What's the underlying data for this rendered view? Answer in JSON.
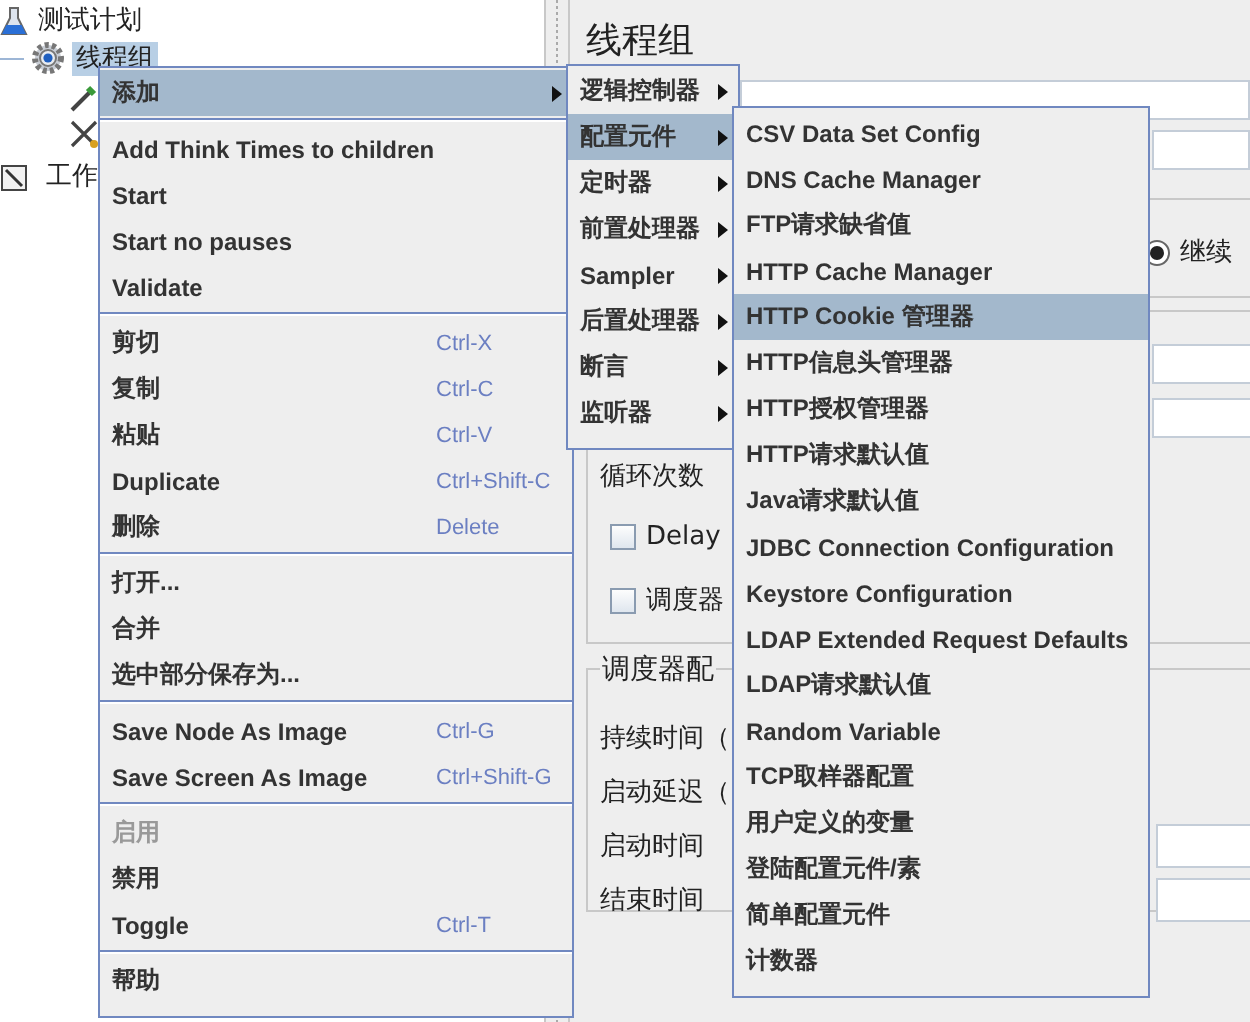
{
  "tree": {
    "items": [
      {
        "label": "测试计划",
        "selected": false,
        "children": [
          {
            "label": "线程组",
            "selected": true
          }
        ]
      },
      {
        "label": "工作",
        "selected": false
      }
    ]
  },
  "panel": {
    "title": "线程组",
    "continue_option": {
      "label": "继续",
      "selected": true
    },
    "loop_count": {
      "label": "循环次数"
    },
    "delay_option": {
      "label": "Delay",
      "checked": false
    },
    "scheduler_option": {
      "label": "调度器",
      "checked": false
    },
    "scheduler_group": {
      "title": "调度器配",
      "rows": [
        {
          "label": "持续时间（",
          "kind": "plain"
        },
        {
          "label": "启动延迟（",
          "kind": "plain"
        },
        {
          "label": "启动时间",
          "kind": "field"
        },
        {
          "label": "结束时间",
          "kind": "field"
        }
      ]
    }
  },
  "context_menu": {
    "items": [
      {
        "kind": "submenu",
        "label": "添加",
        "selected": true,
        "disabled": false
      },
      {
        "kind": "separator"
      },
      {
        "kind": "item",
        "label": "Add Think Times to children",
        "selected": false,
        "disabled": false
      },
      {
        "kind": "item",
        "label": "Start",
        "selected": false,
        "disabled": false
      },
      {
        "kind": "item",
        "label": "Start no pauses",
        "selected": false,
        "disabled": false
      },
      {
        "kind": "item",
        "label": "Validate",
        "selected": false,
        "disabled": false
      },
      {
        "kind": "separator"
      },
      {
        "kind": "item",
        "label": "剪切",
        "shortcut": "Ctrl-X",
        "selected": false,
        "disabled": false
      },
      {
        "kind": "item",
        "label": "复制",
        "shortcut": "Ctrl-C",
        "selected": false,
        "disabled": false
      },
      {
        "kind": "item",
        "label": "粘贴",
        "shortcut": "Ctrl-V",
        "selected": false,
        "disabled": false
      },
      {
        "kind": "item",
        "label": "Duplicate",
        "shortcut": "Ctrl+Shift-C",
        "selected": false,
        "disabled": false
      },
      {
        "kind": "item",
        "label": "删除",
        "shortcut": "Delete",
        "selected": false,
        "disabled": false
      },
      {
        "kind": "separator"
      },
      {
        "kind": "item",
        "label": "打开...",
        "selected": false,
        "disabled": false
      },
      {
        "kind": "item",
        "label": "合并",
        "selected": false,
        "disabled": false
      },
      {
        "kind": "item",
        "label": "选中部分保存为...",
        "selected": false,
        "disabled": false
      },
      {
        "kind": "separator"
      },
      {
        "kind": "item",
        "label": "Save Node As Image",
        "shortcut": "Ctrl-G",
        "selected": false,
        "disabled": false
      },
      {
        "kind": "item",
        "label": "Save Screen As Image",
        "shortcut": "Ctrl+Shift-G",
        "selected": false,
        "disabled": false
      },
      {
        "kind": "separator"
      },
      {
        "kind": "item",
        "label": "启用",
        "selected": false,
        "disabled": true
      },
      {
        "kind": "item",
        "label": "禁用",
        "selected": false,
        "disabled": false
      },
      {
        "kind": "item",
        "label": "Toggle",
        "shortcut": "Ctrl-T",
        "selected": false,
        "disabled": false
      },
      {
        "kind": "separator"
      },
      {
        "kind": "item",
        "label": "帮助",
        "selected": false,
        "disabled": false
      }
    ]
  },
  "add_submenu": {
    "items": [
      {
        "kind": "submenu",
        "label": "逻辑控制器",
        "selected": false
      },
      {
        "kind": "submenu",
        "label": "配置元件",
        "selected": true
      },
      {
        "kind": "submenu",
        "label": "定时器",
        "selected": false
      },
      {
        "kind": "submenu",
        "label": "前置处理器",
        "selected": false
      },
      {
        "kind": "submenu",
        "label": "Sampler",
        "selected": false
      },
      {
        "kind": "submenu",
        "label": "后置处理器",
        "selected": false
      },
      {
        "kind": "submenu",
        "label": "断言",
        "selected": false
      },
      {
        "kind": "submenu",
        "label": "监听器",
        "selected": false
      }
    ]
  },
  "config_submenu": {
    "items": [
      {
        "kind": "item",
        "label": "CSV Data Set Config",
        "selected": false
      },
      {
        "kind": "item",
        "label": "DNS Cache Manager",
        "selected": false
      },
      {
        "kind": "item",
        "label": "FTP请求缺省值",
        "selected": false
      },
      {
        "kind": "item",
        "label": "HTTP Cache Manager",
        "selected": false
      },
      {
        "kind": "item",
        "label": "HTTP Cookie 管理器",
        "selected": true
      },
      {
        "kind": "item",
        "label": "HTTP信息头管理器",
        "selected": false
      },
      {
        "kind": "item",
        "label": "HTTP授权管理器",
        "selected": false
      },
      {
        "kind": "item",
        "label": "HTTP请求默认值",
        "selected": false
      },
      {
        "kind": "item",
        "label": "Java请求默认值",
        "selected": false
      },
      {
        "kind": "item",
        "label": "JDBC Connection Configuration",
        "selected": false
      },
      {
        "kind": "item",
        "label": "Keystore Configuration",
        "selected": false
      },
      {
        "kind": "item",
        "label": "LDAP Extended Request Defaults",
        "selected": false
      },
      {
        "kind": "item",
        "label": "LDAP请求默认值",
        "selected": false
      },
      {
        "kind": "item",
        "label": "Random Variable",
        "selected": false
      },
      {
        "kind": "item",
        "label": "TCP取样器配置",
        "selected": false
      },
      {
        "kind": "item",
        "label": "用户定义的变量",
        "selected": false
      },
      {
        "kind": "item",
        "label": "登陆配置元件/素",
        "selected": false
      },
      {
        "kind": "item",
        "label": "简单配置元件",
        "selected": false
      },
      {
        "kind": "item",
        "label": "计数器",
        "selected": false
      }
    ]
  }
}
